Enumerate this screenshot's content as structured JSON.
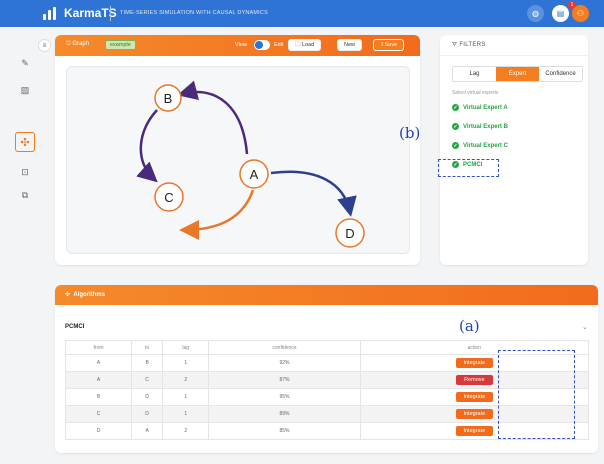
{
  "app": {
    "name": "KarmaTS",
    "tagline": "TIME-SERIES SIMULATION WITH CAUSAL DYNAMICS",
    "notification_count": "1"
  },
  "graph_panel": {
    "title": "Graph",
    "tag": "example",
    "view_label": "View",
    "edit_label": "Edit",
    "load_label": "Load",
    "new_label": "New",
    "save_label": "Save",
    "nodes": [
      "A",
      "B",
      "C",
      "D"
    ]
  },
  "filters": {
    "title": "FILTERS",
    "tabs": [
      "Lag",
      "Expert",
      "Confidence"
    ],
    "active_tab": "Expert",
    "hint": "Select virtual experts",
    "experts": [
      "Virtual Expert A",
      "Virtual Expert B",
      "Virtual Expert C",
      "PCMCI"
    ]
  },
  "algorithms": {
    "title": "Algorithms",
    "algorithm_name": "PCMCI",
    "columns": [
      "from",
      "to",
      "lag",
      "confidence",
      "action"
    ],
    "rows": [
      {
        "from": "A",
        "to": "B",
        "lag": "1",
        "confidence": "92%",
        "action": "Integrate"
      },
      {
        "from": "A",
        "to": "C",
        "lag": "2",
        "confidence": "87%",
        "action": "Remove"
      },
      {
        "from": "B",
        "to": "D",
        "lag": "1",
        "confidence": "95%",
        "action": "Integrate"
      },
      {
        "from": "C",
        "to": "D",
        "lag": "1",
        "confidence": "89%",
        "action": "Integrate"
      },
      {
        "from": "D",
        "to": "A",
        "lag": "2",
        "confidence": "85%",
        "action": "Integrate"
      }
    ]
  },
  "annotations": {
    "a": "(a)",
    "b": "(b)"
  },
  "colors": {
    "accent": "#f47d20",
    "primary": "#2f74d4",
    "edge_purple": "#4a2a7a",
    "edge_orange": "#e8772a",
    "edge_navy": "#2f3f8f",
    "success": "#27a545",
    "danger": "#d63a3a"
  }
}
